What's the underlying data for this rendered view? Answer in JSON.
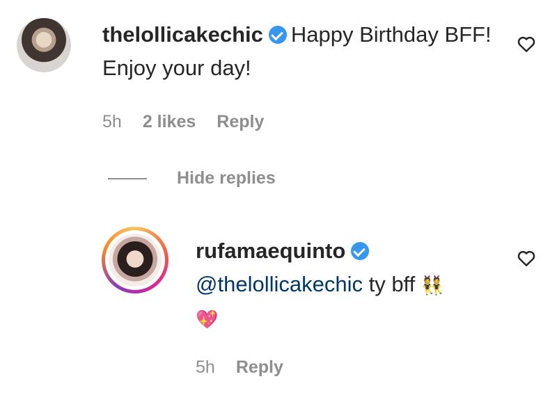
{
  "comments": [
    {
      "username": "thelollicakechic",
      "text": "Happy Birthday BFF! Enjoy your day!",
      "time": "5h",
      "likes": "2 likes",
      "reply_label": "Reply"
    }
  ],
  "replies_toggle": {
    "label": "Hide replies"
  },
  "replies": [
    {
      "username": "rufamaequinto",
      "mention": "@thelollicakechic",
      "text": "ty bff",
      "emoji_1": "👯",
      "emoji_2": "💖",
      "time": "5h",
      "reply_label": "Reply"
    }
  ],
  "colors": {
    "verified": "#3797f0",
    "mention": "#00376b",
    "muted": "#8e8e8e"
  },
  "icons": {
    "like": "heart-outline-icon",
    "verified": "verified-badge-icon"
  }
}
